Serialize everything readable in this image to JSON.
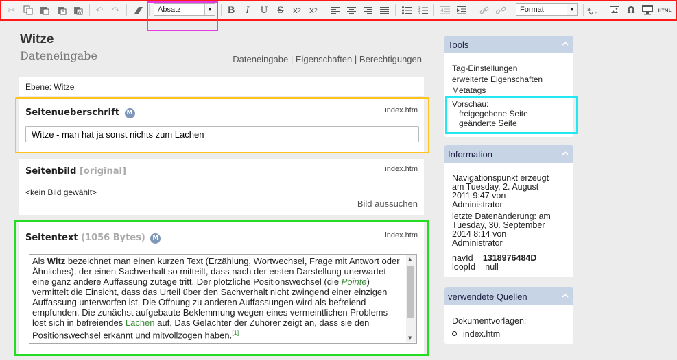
{
  "toolbar": {
    "paragraph_format": "Absatz",
    "styles": "Format",
    "html_label": "HTML",
    "icons": [
      "cut-icon",
      "copy-icon",
      "paste-icon",
      "paste-text-icon",
      "paste-word-icon",
      "undo-icon",
      "redo-icon",
      "remove-format-icon",
      "bold-icon",
      "italic-icon",
      "underline-icon",
      "strikethrough-icon",
      "subscript-icon",
      "superscript-icon",
      "align-left-icon",
      "align-center-icon",
      "align-right-icon",
      "justify-icon",
      "bulleted-list-icon",
      "numbered-list-icon",
      "outdent-icon",
      "indent-icon",
      "link-icon",
      "unlink-icon",
      "spellcheck-icon",
      "image-icon",
      "special-char-icon",
      "preview-icon",
      "source-icon"
    ]
  },
  "page": {
    "title": "Witze",
    "subtitle": "Dateneingabe",
    "tabs": [
      "Dateneingabe",
      "Eigenschaften",
      "Berechtigungen"
    ],
    "tab_separator": "|",
    "ebene": "Ebene: Witze"
  },
  "heading_section": {
    "title": "Seitenueberschrift",
    "badge": "M",
    "file": "index.htm",
    "value": "Witze - man hat ja sonst nichts zum Lachen"
  },
  "image_section": {
    "title": "Seitenbild",
    "qualifier": "[original]",
    "file": "index.htm",
    "status": "<kein Bild gewählt>",
    "action": "Bild aussuchen"
  },
  "text_section": {
    "title": "Seitentext",
    "size": "(1056 Bytes)",
    "badge": "M",
    "file": "index.htm",
    "p1": "Als ",
    "bold": "Witz",
    "p2": " bezeichnet man einen kurzen Text (Erzählung, Wortwechsel, Frage mit Antwort oder Ähnliches), der einen Sachverhalt so mitteilt, dass nach der ersten Darstellung unerwartet eine ganz andere Auffassung zutage tritt. Der plötzliche Positionswechsel (die ",
    "link1": "Pointe",
    "p3": ") vermittelt die Einsicht, dass das Urteil über den Sachverhalt nicht zwingend einer einzigen Auffassung unterworfen ist. Die Öffnung zu anderen Auffassungen wird als befreiend empfunden. Die zunächst aufgebaute Beklemmung wegen eines vermeintlichen Problems löst sich in befreiendes ",
    "link2": "Lachen",
    "p4": " auf. Das Gelächter der Zuhörer zeigt an, dass sie den Positionswechsel erkannt und mitvollzogen haben.",
    "footnote": "[1]"
  },
  "tools_box": {
    "title": "Tools",
    "items": [
      "Tag-Einstellungen",
      "erweiterte Eigenschaften",
      "Metatags"
    ],
    "preview_label": "Vorschau:",
    "preview_items": [
      "freigegebene Seite",
      "geänderte Seite"
    ]
  },
  "info_box": {
    "title": "Information",
    "created_lines": [
      "Navigationspunkt erzeugt",
      "am Tuesday, 2. August",
      "2011 9:47 von",
      "Administrator"
    ],
    "changed_lines": [
      "letzte Datenänderung: am",
      "Tuesday, 30. September",
      "2014 8:14 von",
      "Administrator"
    ],
    "navid_label": "navId = ",
    "navid_value": "1318976484D",
    "loopid": "loopId = null"
  },
  "sources_box": {
    "title": "verwendete Quellen",
    "label": "Dokumentvorlagen:",
    "items": [
      "index.htm"
    ]
  },
  "colors": {
    "toolbar_highlight": "#ff1a1a",
    "format_highlight": "#e63ce6",
    "heading_highlight": "#ffc21a",
    "text_highlight": "#22dd22",
    "preview_highlight": "#22e8f2",
    "box_header": "#c6d4e6",
    "link_green": "#3a8a3a"
  }
}
